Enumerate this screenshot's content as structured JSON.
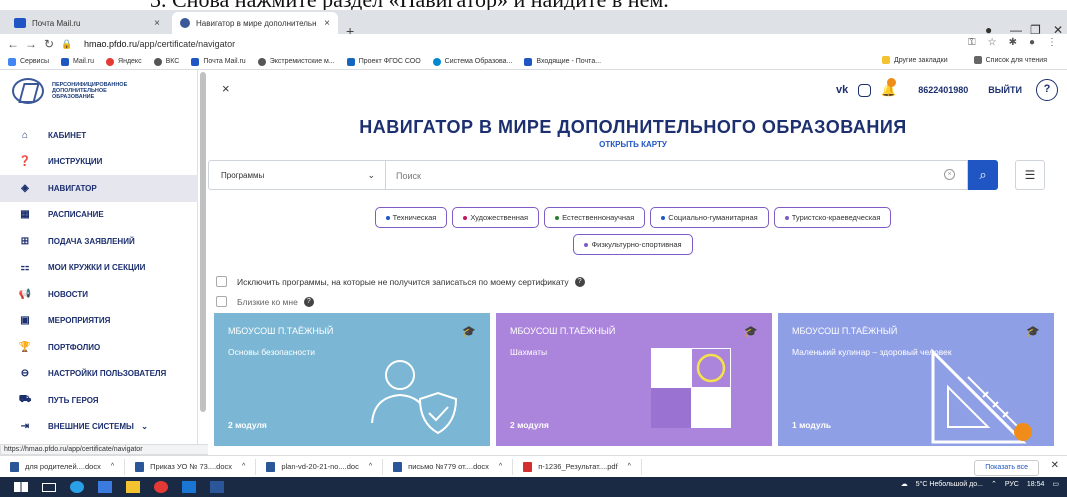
{
  "doc_fragment": "3. Снова нажмите раздел «Навигатор» и найдите в нём.",
  "browser": {
    "tabs": [
      {
        "title": "Почта Mail.ru",
        "close": "×"
      },
      {
        "title": "Навигатор в мире дополнительн",
        "close": "×"
      }
    ],
    "new_tab": "+",
    "url_host": "hmao.pfdo.ru",
    "url_path": "/app/certificate/navigator",
    "bookmarks": [
      "Сервисы",
      "Mail.ru",
      "Яндекс",
      "ВКС",
      "Почта Mail.ru",
      "Экстремистские м...",
      "Проект ФГОС СОО",
      "Система Образова...",
      "Входящие - Почта..."
    ],
    "bookmarks_right": [
      "Другие закладки",
      "Список для чтения"
    ],
    "status_url": "https://hmao.pfdo.ru/app/certificate/navigator"
  },
  "sidebar": {
    "logo_text": "ПЕРСОНИФИЦИРОВАННОЕ ДОПОЛНИТЕЛЬНОЕ ОБРАЗОВАНИЕ",
    "items": [
      {
        "label": "КАБИНЕТ",
        "icon": "home-icon"
      },
      {
        "label": "ИНСТРУКЦИИ",
        "icon": "question-icon"
      },
      {
        "label": "НАВИГАТОР",
        "icon": "compass-icon"
      },
      {
        "label": "РАСПИСАНИЕ",
        "icon": "calendar-icon"
      },
      {
        "label": "ПОДАЧА ЗАЯВЛЕНИЙ",
        "icon": "add-document-icon"
      },
      {
        "label": "МОИ КРУЖКИ И СЕКЦИИ",
        "icon": "sections-icon"
      },
      {
        "label": "НОВОСТИ",
        "icon": "megaphone-icon"
      },
      {
        "label": "МЕРОПРИЯТИЯ",
        "icon": "event-icon"
      },
      {
        "label": "ПОРТФОЛИО",
        "icon": "trophy-icon"
      },
      {
        "label": "НАСТРОЙКИ ПОЛЬЗОВАТЕЛЯ",
        "icon": "user-settings-icon"
      },
      {
        "label": "ПУТЬ ГЕРОЯ",
        "icon": "hero-path-icon"
      },
      {
        "label": "ВНЕШНИЕ СИСТЕМЫ",
        "icon": "external-icon"
      }
    ]
  },
  "header": {
    "close": "×",
    "vk": "vk",
    "phone": "8622401980",
    "logout": "ВЫЙТИ",
    "help": "?"
  },
  "main": {
    "title": "НАВИГАТОР В МИРЕ ДОПОЛНИТЕЛЬНОГО ОБРАЗОВАНИЯ",
    "map_link": "ОТКРЫТЬ КАРТУ",
    "select_value": "Программы",
    "search_placeholder": "Поиск",
    "chips_row1": [
      {
        "label": "Техническая",
        "color": "#1f56c4"
      },
      {
        "label": "Художественная",
        "color": "#c2185b"
      },
      {
        "label": "Естественнонаучная",
        "color": "#2e7d32"
      },
      {
        "label": "Социально-гуманитарная",
        "color": "#1f56c4"
      },
      {
        "label": "Туристско-краеведческая",
        "color": "#7e5cc4"
      }
    ],
    "chips_row2": [
      {
        "label": "Физкультурно-спортивная",
        "color": "#7e5cc4"
      }
    ],
    "check1": "Исключить программы, на которые не получится записаться по моему сертификату",
    "check2": "Близкие ко мне"
  },
  "cards": [
    {
      "org": "МБОУСОШ П.ТАЁЖНЫЙ",
      "program": "Основы безопасности",
      "modules": "2 модуля",
      "color": "#7bb7d4"
    },
    {
      "org": "МБОУСОШ П.ТАЁЖНЫЙ",
      "program": "Шахматы",
      "modules": "2 модуля",
      "color": "#ab85dc"
    },
    {
      "org": "МБОУСОШ П.ТАЁЖНЫЙ",
      "program": "Маленький кулинар – здоровый человек",
      "modules": "1 модуль",
      "color": "#8f9fe6"
    }
  ],
  "downloads": [
    "для родителей....docx",
    "Приказ УО № 73....docx",
    "plan-vd-20-21-no....doc",
    "письмо №779 от....docx",
    "п-1236_Результат....pdf"
  ],
  "show_all": "Показать все",
  "tray": {
    "weather": "5°C Небольшой до...",
    "lang": "РУС",
    "time": "18:54"
  }
}
